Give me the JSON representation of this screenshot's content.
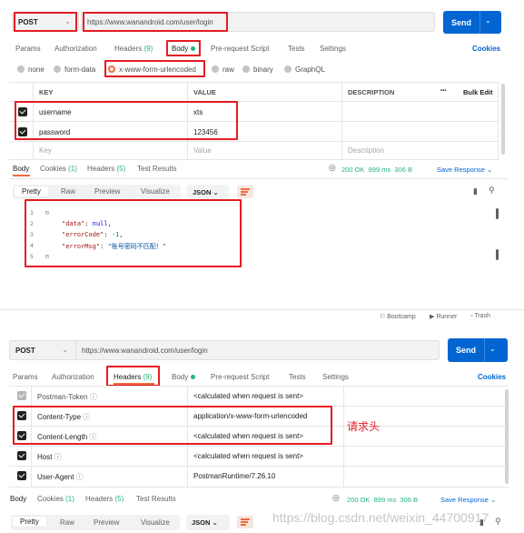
{
  "top": {
    "method": "POST",
    "url": "https://www.wanandroid.com/user/login",
    "send_label": "Send",
    "tabs": {
      "params": "Params",
      "authorization": "Authorization",
      "headers": "Headers",
      "headers_count": "(9)",
      "body": "Body",
      "pre_request": "Pre-request Script",
      "tests": "Tests",
      "settings": "Settings"
    },
    "cookies": "Cookies",
    "body_types": [
      "none",
      "form-data",
      "x-www-form-urlencoded",
      "raw",
      "binary",
      "GraphQL"
    ],
    "table": {
      "headers": [
        "KEY",
        "VALUE",
        "DESCRIPTION"
      ],
      "bulk_edit": "Bulk Edit",
      "more": "•••",
      "rows": [
        {
          "key": "username",
          "value": "xts"
        },
        {
          "key": "password",
          "value": "123456"
        }
      ],
      "placeholder": {
        "key": "Key",
        "value": "Value",
        "description": "Description"
      }
    },
    "response_tabs": {
      "body": "Body",
      "cookies": "Cookies",
      "cookies_count": "(1)",
      "headers": "Headers",
      "headers_count": "(5)",
      "test_results": "Test Results"
    },
    "status": "200 OK",
    "time": "899 ms",
    "size": "306 B",
    "save_response": "Save Response",
    "view_modes": [
      "Pretty",
      "Raw",
      "Preview",
      "Visualize"
    ],
    "format": "JSON",
    "json_lines": [
      "1",
      "2",
      "3",
      "4",
      "5"
    ],
    "json": {
      "k1": "\"data\"",
      "v1": "null",
      "k2": "\"errorCode\"",
      "v2": "-1",
      "k3": "\"errorMsg\"",
      "v3": "\"账号密码不匹配！\""
    },
    "footer": {
      "bootcamp": "Bootcamp",
      "runner": "Runner",
      "trash": "Trash"
    }
  },
  "bottom": {
    "method": "POST",
    "url": "https://www.wanandroid.com/user/login",
    "send_label": "Send",
    "tabs": {
      "params": "Params",
      "authorization": "Authorization",
      "headers": "Headers",
      "headers_count": "(9)",
      "body": "Body",
      "pre_request": "Pre-request Script",
      "tests": "Tests",
      "settings": "Settings"
    },
    "cookies": "Cookies",
    "header_rows": [
      {
        "key": "Postman-Token",
        "value": "<calculated when request is sent>"
      },
      {
        "key": "Content-Type",
        "value": "application/x-www-form-urlencoded"
      },
      {
        "key": "Content-Length",
        "value": "<calculated when request is sent>"
      },
      {
        "key": "Host",
        "value": "<calculated when request is sent>"
      },
      {
        "key": "User-Agent",
        "value": "PostmanRuntime/7.26.10"
      }
    ],
    "annotation": "请求头",
    "response_tabs": {
      "body": "Body",
      "cookies": "Cookies",
      "cookies_count": "(1)",
      "headers": "Headers",
      "headers_count": "(5)",
      "test_results": "Test Results"
    },
    "status": "200 OK",
    "time": "899 ms",
    "size": "306 B",
    "save_response": "Save Response",
    "view_modes": [
      "Pretty",
      "Raw",
      "Preview",
      "Visualize"
    ],
    "format": "JSON"
  },
  "watermark": "https://blog.csdn.net/weixin_44700917",
  "colors": {
    "accent_red": "#e51c23",
    "send_blue": "#0265d2",
    "status_green": "#26b47f",
    "radio_orange": "#f26b3a"
  }
}
